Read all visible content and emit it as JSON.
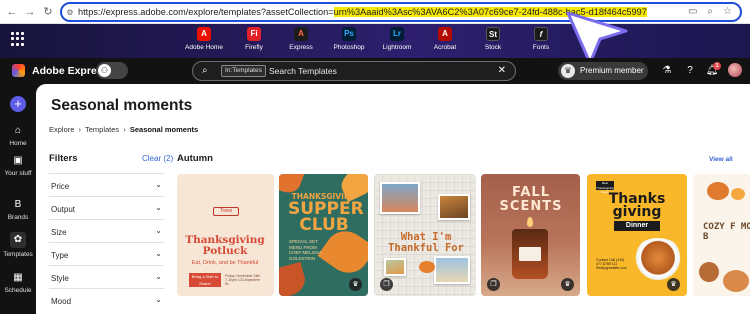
{
  "browser": {
    "url_prefix": "https://express.adobe.com/explore/templates?assetCollection=",
    "url_highlight": "urn%3Aaaid%3Asc%3AVA6C2%3A07c69ce7-24fd-488c-bac5-d18f464c5997"
  },
  "apps": [
    {
      "label": "Adobe Home",
      "abbr": "A",
      "color": "#eb1000"
    },
    {
      "label": "Firefly",
      "abbr": "Fi",
      "color": "#e41f26"
    },
    {
      "label": "Express",
      "abbr": "A",
      "color": "#1c1c1c"
    },
    {
      "label": "Photoshop",
      "abbr": "Ps",
      "color": "#001e36"
    },
    {
      "label": "Lightroom",
      "abbr": "Lr",
      "color": "#001d34"
    },
    {
      "label": "Acrobat",
      "abbr": "A",
      "color": "#b30b00"
    },
    {
      "label": "Stock",
      "abbr": "St",
      "color": "#1a1a1a"
    },
    {
      "label": "Fonts",
      "abbr": "f",
      "color": "#1a1a1a"
    }
  ],
  "header": {
    "app_name": "Adobe Express",
    "search_chip": "In:Templates",
    "search_placeholder": "Search Templates",
    "premium_label": "Premium member",
    "notification_count": "1"
  },
  "rail": [
    {
      "label": "Home",
      "icon": "home-icon"
    },
    {
      "label": "Your stuff",
      "icon": "folder-icon"
    },
    {
      "label": "Brands",
      "icon": "brand-icon"
    },
    {
      "label": "Templates",
      "icon": "templates-icon"
    },
    {
      "label": "Schedule",
      "icon": "calendar-icon"
    }
  ],
  "page": {
    "title": "Seasonal moments",
    "breadcrumb": [
      "Explore",
      "Templates",
      "Seasonal moments"
    ]
  },
  "filters": {
    "title": "Filters",
    "clear_label": "Clear (2)",
    "items": [
      "Price",
      "Output",
      "Size",
      "Type",
      "Style",
      "Mood"
    ]
  },
  "section": {
    "title": "Autumn",
    "view_all": "View all"
  },
  "cards": {
    "c1": {
      "tag": "Trees",
      "title": "Thanksgiving Potluck",
      "subtitle": "Eat, Drink, and be Thankful",
      "cta": "Bring a Dish to Share!",
      "info": "Friday, November 24th 7-10pm 123 Anywhere St."
    },
    "c2": {
      "title_small": "THANKSGIVING",
      "title_big": "SUPPER CLUB",
      "info": "SPECIAL SET MENU FROM CHEF MELISSA GOLDSTEIN"
    },
    "c3": {
      "title": "What I'm Thankful For"
    },
    "c4": {
      "title": "FALL SCENTS"
    },
    "c5": {
      "tag": "Best Thanksgiving Meals",
      "title": "Thanks giving",
      "dinner": "Dinner",
      "info": "Contact Call (415) 477-5785 111 Reallygreatsite.com"
    },
    "c6": {
      "title": "COZY F MOOD B"
    }
  }
}
